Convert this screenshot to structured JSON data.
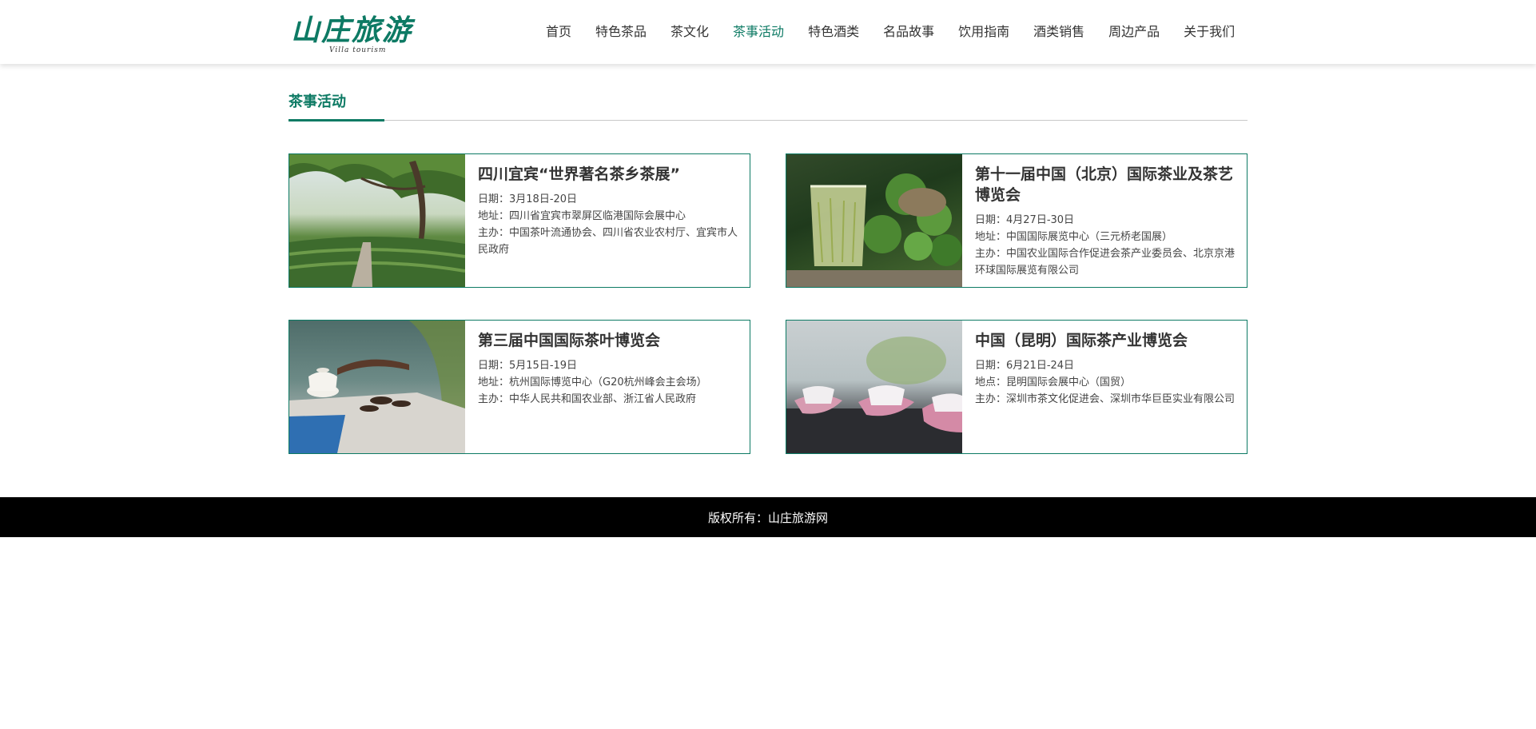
{
  "logo": {
    "main": "山庄旅游",
    "sub": "Villa tourism"
  },
  "nav": {
    "items": [
      {
        "label": "首页"
      },
      {
        "label": "特色茶品"
      },
      {
        "label": "茶文化"
      },
      {
        "label": "茶事活动",
        "active": true
      },
      {
        "label": "特色酒类"
      },
      {
        "label": "名品故事"
      },
      {
        "label": "饮用指南"
      },
      {
        "label": "酒类销售"
      },
      {
        "label": "周边产品"
      },
      {
        "label": "关于我们"
      }
    ]
  },
  "section": {
    "title": "茶事活动"
  },
  "events": [
    {
      "title": "四川宜宾“世界著名茶乡茶展”",
      "date": "日期：3月18日-20日",
      "place": "地址：四川省宜宾市翠屏区临港国际会展中心",
      "host": "主办：中国茶叶流通协会、四川省农业农村厅、宜宾市人民政府"
    },
    {
      "title": "第十一届中国（北京）国际茶业及茶艺博览会",
      "date": "日期：4月27日-30日",
      "place": "地址：中国国际展览中心（三元桥老国展）",
      "host": "主办：中国农业国际合作促进会茶产业委员会、北京京港环球国际展览有限公司"
    },
    {
      "title": "第三届中国国际茶叶博览会",
      "date": "日期：5月15日-19日",
      "place": "地址：杭州国际博览中心（G20杭州峰会主会场）",
      "host": "主办：中华人民共和国农业部、浙江省人民政府"
    },
    {
      "title": "中国（昆明）国际茶产业博览会",
      "date": "日期：6月21日-24日",
      "place": "地点：昆明国际会展中心（国贸）",
      "host": "主办：深圳市茶文化促进会、深圳市华巨臣实业有限公司"
    }
  ],
  "footer": {
    "text": "版权所有：山庄旅游网"
  },
  "colors": {
    "accent": "#0d7a64",
    "footer_bg": "#000000"
  }
}
